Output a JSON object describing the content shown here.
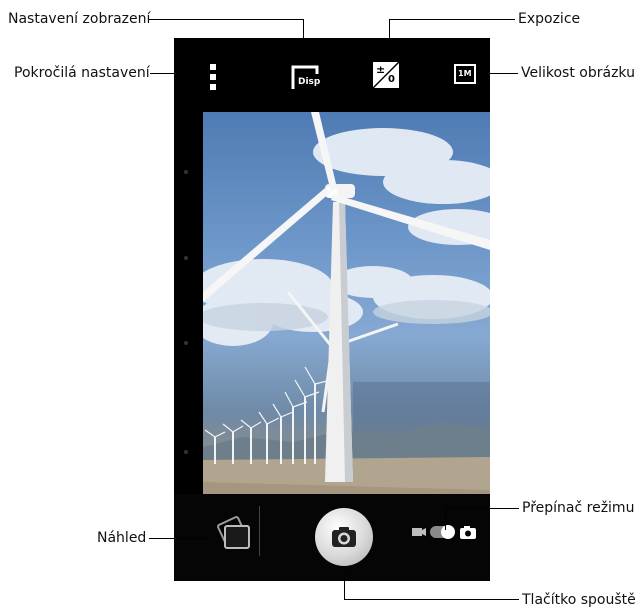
{
  "callouts": {
    "display_settings": "Nastavení zobrazení",
    "exposure": "Expozice",
    "advanced_settings": "Pokročilá nastavení",
    "image_size": "Velikost obrázku",
    "mode_switch": "Přepínač režimu",
    "preview": "Náhled",
    "shutter_button": "Tlačítko spouště"
  },
  "icons": {
    "more": "vertical-dots-icon",
    "display": "disp-icon",
    "exposure": "exposure-icon",
    "image_size": "resolution-1m-icon",
    "gallery": "gallery-icon",
    "shutter": "camera-icon",
    "video": "video-icon",
    "photo": "photo-camera-icon"
  },
  "topbar": {
    "display_icon_text": "Disp",
    "exposure_plus": "±",
    "exposure_zero": "0",
    "image_size_text": "1M"
  },
  "colors": {
    "phone_bg": "#000000",
    "toggle_track": "#8a8a8a",
    "shutter_ring": "#d8d8d8"
  }
}
